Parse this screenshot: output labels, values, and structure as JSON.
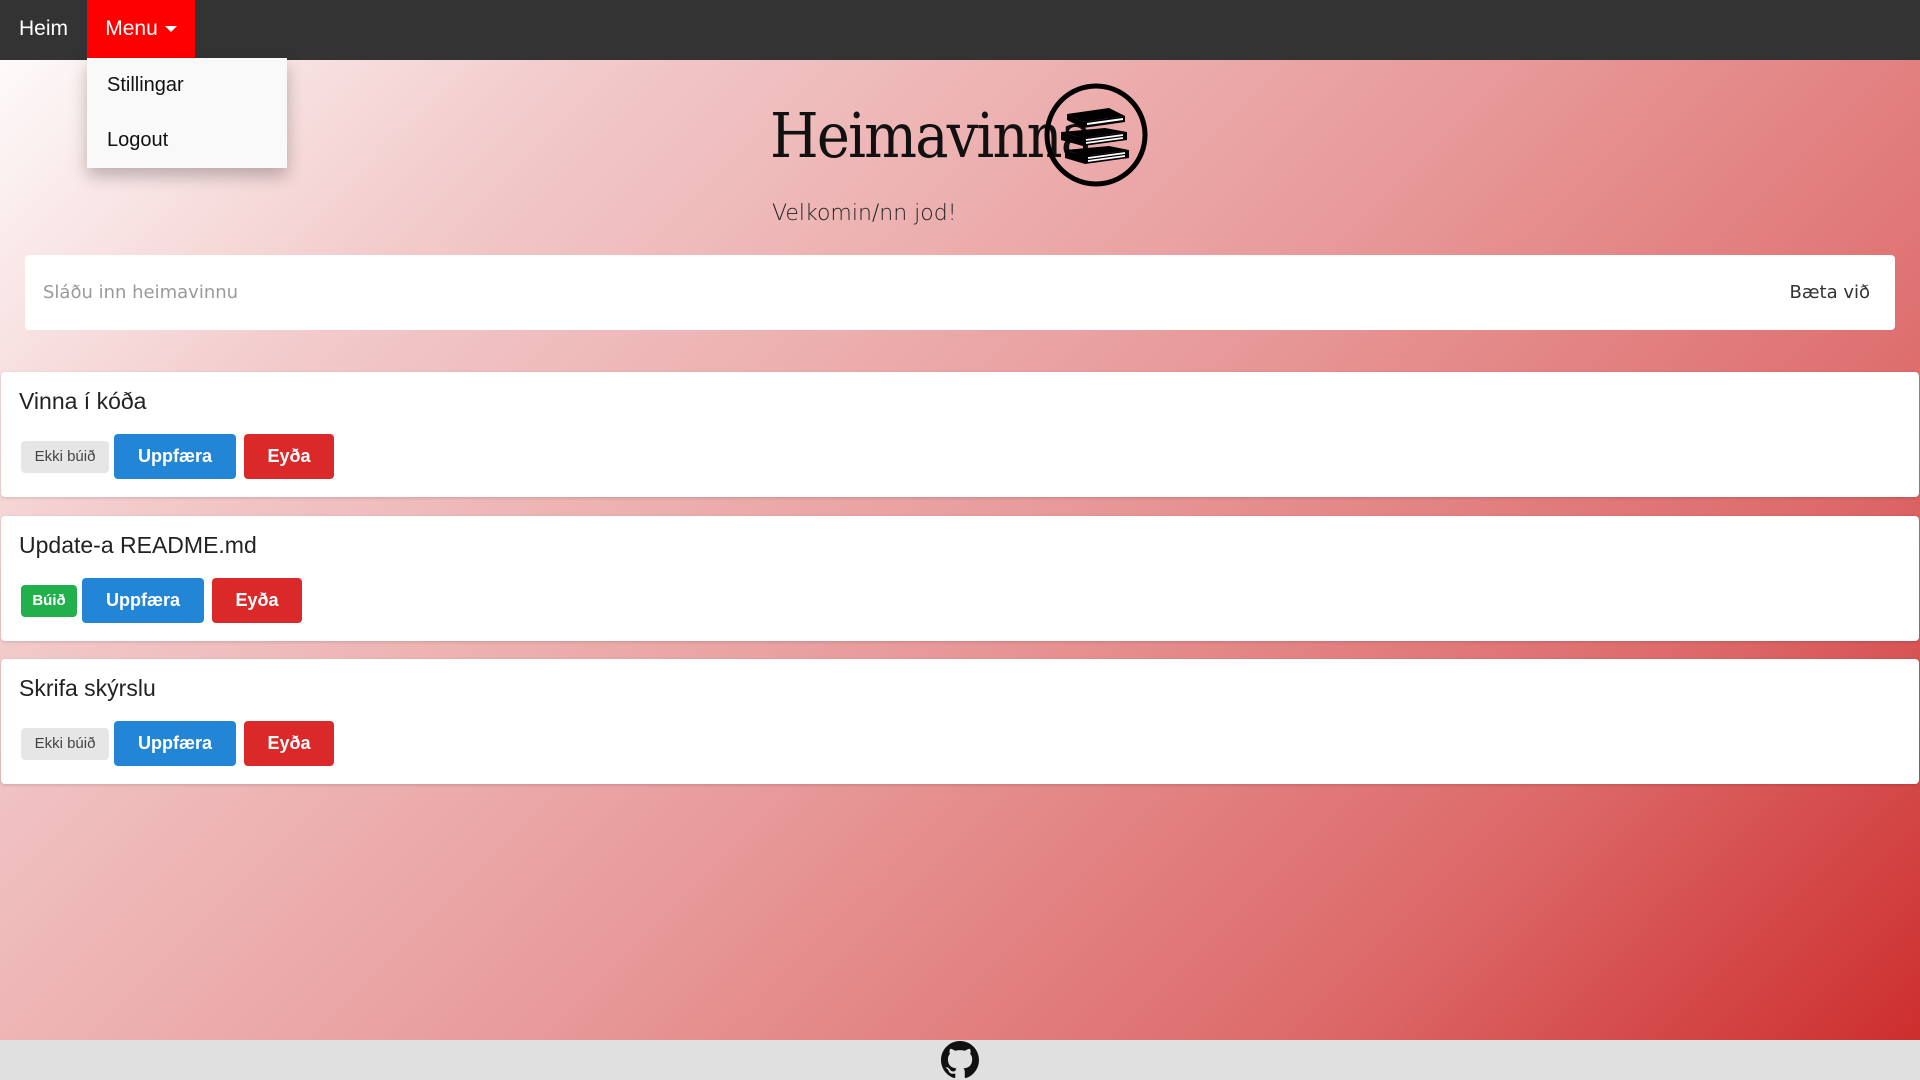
{
  "nav": {
    "home_label": "Heim",
    "menu_label": "Menu",
    "dropdown": [
      {
        "label": "Stillingar"
      },
      {
        "label": "Logout"
      }
    ]
  },
  "header": {
    "title": "Heimavinna",
    "welcome": "Velkomin/nn jod!"
  },
  "add_form": {
    "placeholder": "Sláðu inn heimavinnu",
    "button_label": "Bæta við"
  },
  "tasks": [
    {
      "title": "Vinna í kóða",
      "status": "Ekki búið",
      "update_label": "Uppfæra",
      "delete_label": "Eyða"
    },
    {
      "title": "Update-a README.md",
      "status": "Búið",
      "update_label": "Uppfæra",
      "delete_label": "Eyða"
    },
    {
      "title": "Skrifa skýrslu",
      "status": "Ekki búið",
      "update_label": "Uppfæra",
      "delete_label": "Eyða"
    }
  ],
  "colors": {
    "nav_bg": "#333333",
    "menu_active": "#ff0000",
    "update_button": "#2285d5",
    "delete_button": "#db2828",
    "done_badge": "#21b04b",
    "pending_badge": "#e6e6e6"
  },
  "icons": {
    "logo": "books-stack-icon",
    "footer": "github-icon"
  }
}
